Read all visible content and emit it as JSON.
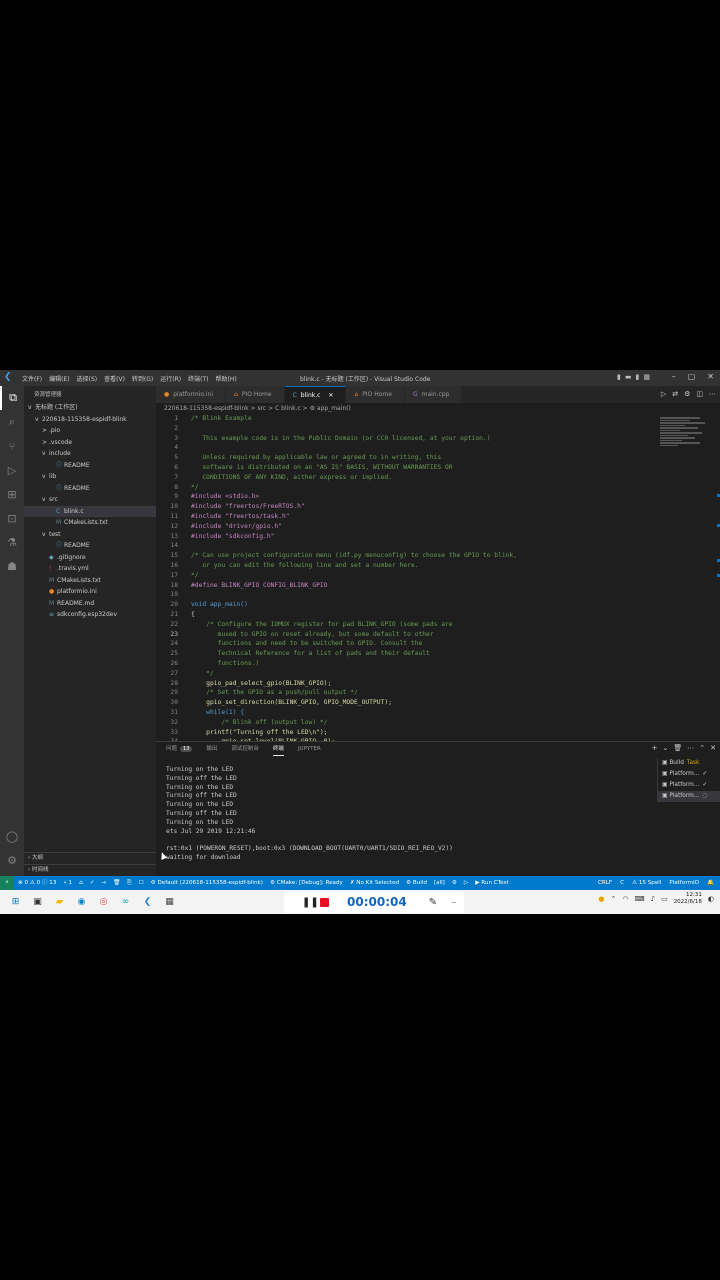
{
  "window": {
    "title": "blink.c - 无标题 (工作区) - Visual Studio Code",
    "menus": [
      "文件(F)",
      "编辑(E)",
      "选择(S)",
      "查看(V)",
      "转到(G)",
      "运行(R)",
      "终端(T)",
      "帮助(H)"
    ]
  },
  "sidebar": {
    "header": "资源管理器",
    "workspace": "无标题 (工作区)",
    "tree": [
      {
        "label": "220618-115358-espidf-blink",
        "indent": 1,
        "chev": "v",
        "icon": "",
        "selected": false
      },
      {
        "label": ".pio",
        "indent": 2,
        "chev": ">",
        "icon": "",
        "selected": false
      },
      {
        "label": ".vscode",
        "indent": 2,
        "chev": ">",
        "icon": "",
        "selected": false
      },
      {
        "label": "include",
        "indent": 2,
        "chev": "v",
        "icon": "",
        "selected": false
      },
      {
        "label": "README",
        "indent": 3,
        "chev": "",
        "icon": "ⓘ",
        "selected": false
      },
      {
        "label": "lib",
        "indent": 2,
        "chev": "v",
        "icon": "",
        "selected": false
      },
      {
        "label": "README",
        "indent": 3,
        "chev": "",
        "icon": "ⓘ",
        "selected": false
      },
      {
        "label": "src",
        "indent": 2,
        "chev": "v",
        "icon": "",
        "selected": false
      },
      {
        "label": "blink.c",
        "indent": 3,
        "chev": "",
        "icon": "C",
        "selected": true
      },
      {
        "label": "CMakeLists.txt",
        "indent": 3,
        "chev": "",
        "icon": "M",
        "selected": false
      },
      {
        "label": "test",
        "indent": 2,
        "chev": "v",
        "icon": "",
        "selected": false
      },
      {
        "label": "README",
        "indent": 3,
        "chev": "",
        "icon": "ⓘ",
        "selected": false
      },
      {
        "label": ".gitignore",
        "indent": 2,
        "chev": "",
        "icon": "◆",
        "selected": false
      },
      {
        "label": ".travis.yml",
        "indent": 2,
        "chev": "",
        "icon": "!",
        "selected": false
      },
      {
        "label": "CMakeLists.txt",
        "indent": 2,
        "chev": "",
        "icon": "M",
        "selected": false
      },
      {
        "label": "platformio.ini",
        "indent": 2,
        "chev": "",
        "icon": "●",
        "selected": false
      },
      {
        "label": "README.md",
        "indent": 2,
        "chev": "",
        "icon": "M",
        "selected": false
      },
      {
        "label": "sdkconfig.esp32dev",
        "indent": 2,
        "chev": "",
        "icon": "≡",
        "selected": false
      }
    ],
    "footer": [
      "大纲",
      "时间线"
    ]
  },
  "tabs": [
    {
      "label": "platformio.ini",
      "icon": "●",
      "active": false
    },
    {
      "label": "PIO Home",
      "icon": "⌂",
      "active": false
    },
    {
      "label": "blink.c",
      "icon": "C",
      "active": true
    },
    {
      "label": "PIO Home",
      "icon": "⌂",
      "active": false
    },
    {
      "label": "main.cpp",
      "icon": "G",
      "active": false
    }
  ],
  "breadcrumb": "220618-115358-espidf-blink > src > C blink.c > ⚙ app_main()",
  "code": [
    {
      "n": "1",
      "t": "/* Blink Example"
    },
    {
      "n": "2",
      "t": ""
    },
    {
      "n": "3",
      "t": "   This example code is in the Public Domain (or CC0 licensed, at your option.)"
    },
    {
      "n": "4",
      "t": ""
    },
    {
      "n": "5",
      "t": "   Unless required by applicable law or agreed to in writing, this"
    },
    {
      "n": "6",
      "t": "   software is distributed on an \"AS IS\" BASIS, WITHOUT WARRANTIES OR"
    },
    {
      "n": "7",
      "t": "   CONDITIONS OF ANY KIND, either express or implied."
    },
    {
      "n": "8",
      "t": "*/"
    },
    {
      "n": "9",
      "t": "#include <stdio.h>"
    },
    {
      "n": "10",
      "t": "#include \"freertos/FreeRTOS.h\""
    },
    {
      "n": "11",
      "t": "#include \"freertos/task.h\""
    },
    {
      "n": "12",
      "t": "#include \"driver/gpio.h\""
    },
    {
      "n": "13",
      "t": "#include \"sdkconfig.h\""
    },
    {
      "n": "14",
      "t": ""
    },
    {
      "n": "15",
      "t": "/* Can use project configuration menu (idf.py menuconfig) to choose the GPIO to blink,"
    },
    {
      "n": "16",
      "t": "   or you can edit the following line and set a number here."
    },
    {
      "n": "17",
      "t": "*/"
    },
    {
      "n": "18",
      "t": "#define BLINK_GPIO CONFIG_BLINK_GPIO"
    },
    {
      "n": "19",
      "t": ""
    },
    {
      "n": "20",
      "t": "void app_main()"
    },
    {
      "n": "21",
      "t": "{"
    },
    {
      "n": "22",
      "t": "    /* Configure the IOMUX register for pad BLINK_GPIO (some pads are"
    },
    {
      "n": "23",
      "t": "       muxed to GPIO on reset already, but some default to other"
    },
    {
      "n": "24",
      "t": "       functions and need to be switched to GPIO. Consult the"
    },
    {
      "n": "25",
      "t": "       Technical Reference for a list of pads and their default"
    },
    {
      "n": "26",
      "t": "       functions.)"
    },
    {
      "n": "27",
      "t": "    */"
    },
    {
      "n": "28",
      "t": "    gpio_pad_select_gpio(BLINK_GPIO);"
    },
    {
      "n": "29",
      "t": "    /* Set the GPIO as a push/pull output */"
    },
    {
      "n": "30",
      "t": "    gpio_set_direction(BLINK_GPIO, GPIO_MODE_OUTPUT);"
    },
    {
      "n": "31",
      "t": "    while(1) {"
    },
    {
      "n": "32",
      "t": "        /* Blink off (output low) */"
    },
    {
      "n": "33",
      "t": "    printf(\"Turning off the LED\\n\");"
    },
    {
      "n": "34",
      "t": "        gpio_set_level(BLINK_GPIO, 0);"
    }
  ],
  "current_line": "23",
  "panel": {
    "tabs": [
      "问题",
      "输出",
      "调试控制台",
      "终端",
      "JUPYTER"
    ],
    "problems_count": "13",
    "active_tab": "终端",
    "terminal": [
      "Turning on the LED",
      "Turning off the LED",
      "Turning on the LED",
      "Turning off the LED",
      "Turning on the LED",
      "Turning off the LED",
      "Turning on the LED",
      "ets Jul 29 2019 12:21:46",
      "",
      "rst:0x1 (POWERON_RESET),boot:0x3 (DOWNLOAD_BOOT(UART0/UART1/SDIO_REI_REO_V2))",
      "waiting for download"
    ],
    "terminal_list": [
      {
        "label": "Build",
        "task": "Task",
        "status": "",
        "sel": false
      },
      {
        "label": "Platform...",
        "task": "",
        "status": "✓",
        "sel": false
      },
      {
        "label": "Platform...",
        "task": "",
        "status": "✓",
        "sel": false
      },
      {
        "label": "Platform...",
        "task": "",
        "status": "◌",
        "sel": true
      }
    ]
  },
  "statusbar": {
    "left": [
      "⊗ 0 ⚠ 0 ⓘ 13",
      "⑂ 1",
      "⌂",
      "✓",
      "→",
      "🗑",
      "⎘",
      "☐",
      "⚙ Default (220618-115358-espidf-blink)",
      "⚙ CMake: [Debug]: Ready",
      "✗ No Kit Selected",
      "⚙ Build",
      "[all]",
      "⚙",
      "▷",
      "▶ Run CTest"
    ],
    "right": [
      "CRLF",
      "C",
      "⚠ 15 Spell",
      "PlatformIO",
      "🔔"
    ]
  },
  "recorder": {
    "time": "00:00:04"
  },
  "taskbar": {
    "clock_time": "12:31",
    "clock_date": "2022/6/18"
  }
}
